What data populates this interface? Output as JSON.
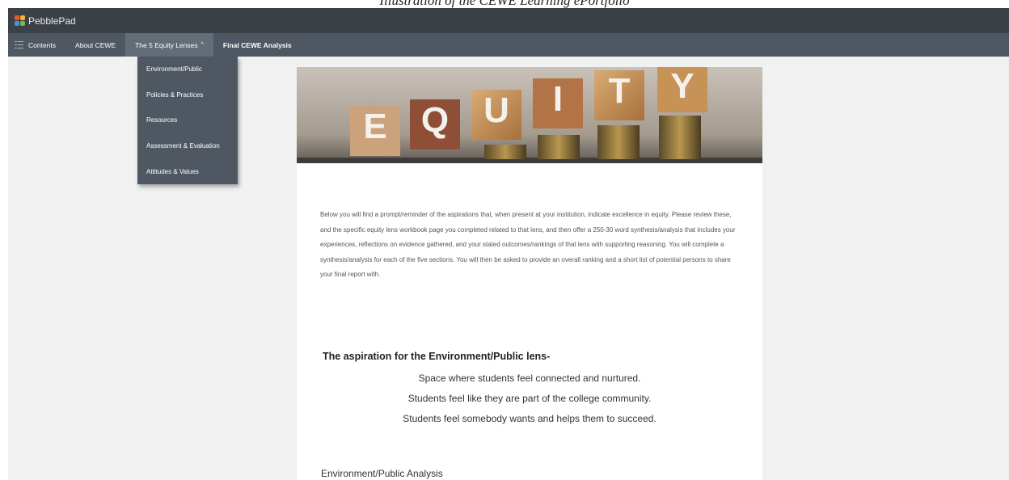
{
  "caption": "Illustration of the CEWE Learning ePortfolio",
  "app": {
    "name": "PebblePad"
  },
  "nav": {
    "contents": "Contents",
    "about": "About CEWE",
    "lenses": "The 5 Equity Lenses",
    "final": "Final CEWE Analysis"
  },
  "dropdown": {
    "items": [
      {
        "label": "Environment/Public"
      },
      {
        "label": "Policies & Practices"
      },
      {
        "label": "Resources"
      },
      {
        "label": "Assessment & Evaluation"
      },
      {
        "label": "Attitudes & Values"
      }
    ]
  },
  "banner": {
    "letters": [
      "E",
      "Q",
      "U",
      "I",
      "T",
      "Y"
    ]
  },
  "intro": "Below you will find a prompt/reminder of the aspirations that, when present at your institution, indicate excellence in equity. Please review these, and the specific equity lens workbook page you completed related to that lens, and then offer a 250-30 word synthesis/analysis that includes your experiences, reflections on evidence gathered, and your stated outcomes/rankings of that lens with supporting reasoning. You will complete a synthesis/analysis for each of the five sections. You will then be asked to provide an overall ranking and a short list of potential persons to share your final report with.",
  "aspiration": {
    "heading": "The aspiration for the Environment/Public lens-",
    "lines": [
      "Space where students feel connected and nurtured.",
      "Students feel like they are part of the college community.",
      "Students feel somebody wants and helps them to succeed."
    ]
  },
  "analysis_heading": "Environment/Public Analysis",
  "colors": {
    "topbar": "#3c4148",
    "navbar": "#4f5862",
    "page_bg": "#f1f1f1",
    "logo": [
      "#e8562a",
      "#f2b632",
      "#3c9ad6",
      "#72b84a"
    ]
  }
}
